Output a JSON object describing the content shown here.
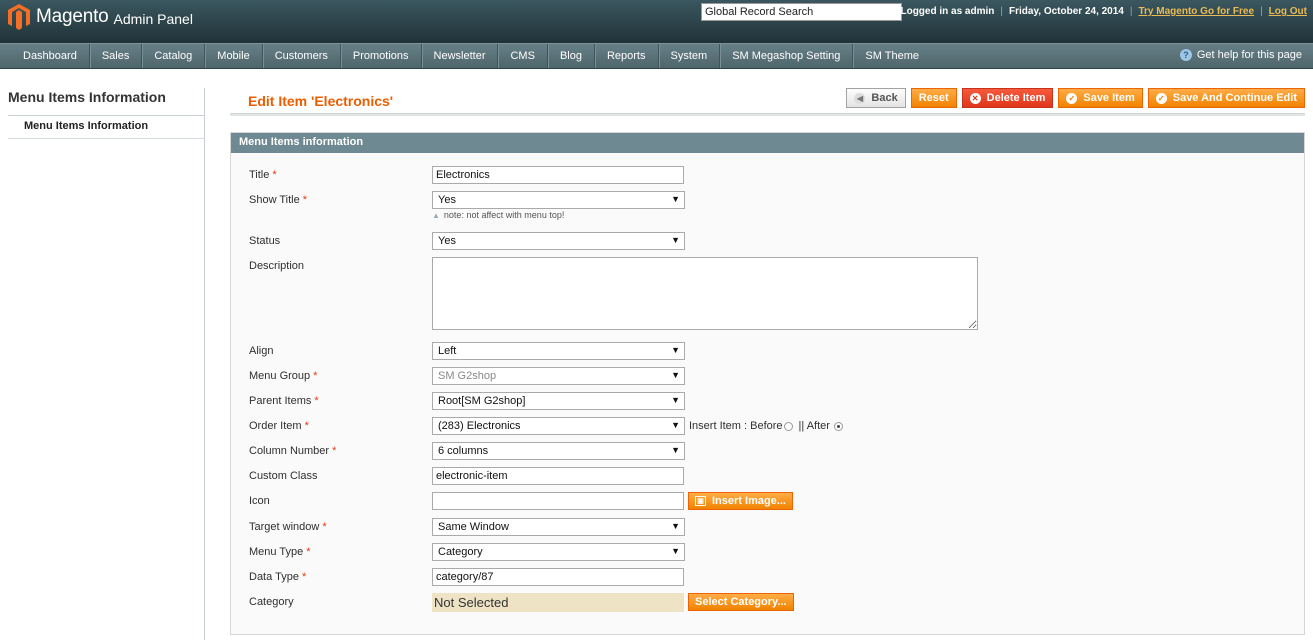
{
  "header": {
    "logo_text": "Magento",
    "logo_sub": "Admin Panel",
    "search_value": "Global Record Search",
    "logged_in": "Logged in as admin",
    "date": "Friday, October 24, 2014",
    "try_link": "Try Magento Go for Free",
    "logout": "Log Out"
  },
  "nav": {
    "items": [
      "Dashboard",
      "Sales",
      "Catalog",
      "Mobile",
      "Customers",
      "Promotions",
      "Newsletter",
      "CMS",
      "Blog",
      "Reports",
      "System",
      "SM Megashop Setting",
      "SM Theme"
    ],
    "help": "Get help for this page"
  },
  "sidebar": {
    "title": "Menu Items Information",
    "tab": "Menu Items Information"
  },
  "content": {
    "title": "Edit Item 'Electronics'",
    "buttons": {
      "back": "Back",
      "reset": "Reset",
      "delete": "Delete Item",
      "save": "Save Item",
      "save_continue": "Save And Continue Edit"
    }
  },
  "form": {
    "section_title": "Menu Items information",
    "title": {
      "label": "Title",
      "value": "Electronics"
    },
    "show_title": {
      "label": "Show Title",
      "value": "Yes",
      "note": "note: not affect with menu top!"
    },
    "status": {
      "label": "Status",
      "value": "Yes"
    },
    "description": {
      "label": "Description",
      "value": ""
    },
    "align": {
      "label": "Align",
      "value": "Left"
    },
    "menu_group": {
      "label": "Menu Group",
      "value": "SM G2shop"
    },
    "parent_items": {
      "label": "Parent Items",
      "value": "Root[SM G2shop]"
    },
    "order_item": {
      "label": "Order Item",
      "value": "(283) Electronics",
      "insert_label": "Insert Item : Before",
      "after_label": "|| After",
      "insert_position": "After"
    },
    "column_number": {
      "label": "Column Number",
      "value": "6 columns"
    },
    "custom_class": {
      "label": "Custom Class",
      "value": "electronic-item"
    },
    "icon": {
      "label": "Icon",
      "value": "",
      "button": "Insert Image..."
    },
    "target_window": {
      "label": "Target window",
      "value": "Same Window"
    },
    "menu_type": {
      "label": "Menu Type",
      "value": "Category"
    },
    "data_type": {
      "label": "Data Type",
      "value": "category/87"
    },
    "category": {
      "label": "Category",
      "value": "Not Selected",
      "button": "Select Category..."
    }
  },
  "colors": {
    "header_bg": "#2c4249",
    "nav_bg": "#5a7178",
    "accent_orange": "#f18200",
    "title_orange": "#eb5e00",
    "section_head": "#6f8992",
    "required": "#eb340a"
  }
}
